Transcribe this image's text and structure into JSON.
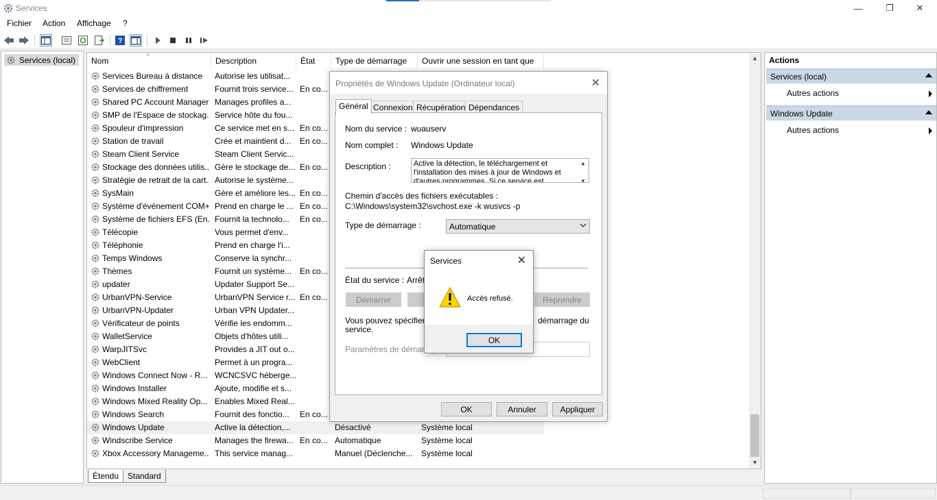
{
  "window": {
    "title": "Services",
    "controls": [
      "minimize-icon",
      "maximize-icon",
      "close-icon"
    ]
  },
  "menu": [
    "Fichier",
    "Action",
    "Affichage",
    "?"
  ],
  "tree": {
    "root": "Services (local)"
  },
  "columns": [
    "Nom",
    "Description",
    "État",
    "Type de démarrage",
    "Ouvrir une session en tant que"
  ],
  "rows": [
    {
      "name": "Services Bureau à distance",
      "desc": "Autorise les utilisat...",
      "state": "",
      "start": "",
      "logon": ""
    },
    {
      "name": "Services de chiffrement",
      "desc": "Fournit trois service...",
      "state": "En co...",
      "start": "",
      "logon": ""
    },
    {
      "name": "Shared PC Account Manager",
      "desc": "Manages profiles a...",
      "state": "",
      "start": "",
      "logon": ""
    },
    {
      "name": "SMP de l'Espace de stockag...",
      "desc": "Service hôte du fou...",
      "state": "",
      "start": "",
      "logon": ""
    },
    {
      "name": "Spouleur d'impression",
      "desc": "Ce service met en s...",
      "state": "En co...",
      "start": "",
      "logon": ""
    },
    {
      "name": "Station de travail",
      "desc": "Crée et maintient d...",
      "state": "En co...",
      "start": "",
      "logon": ""
    },
    {
      "name": "Steam Client Service",
      "desc": "Steam Client Servic...",
      "state": "",
      "start": "",
      "logon": ""
    },
    {
      "name": "Stockage des données utilis...",
      "desc": "Gère le stockage de...",
      "state": "En co...",
      "start": "",
      "logon": ""
    },
    {
      "name": "Stratégie de retrait de la cart...",
      "desc": "Autorise le système...",
      "state": "",
      "start": "",
      "logon": ""
    },
    {
      "name": "SysMain",
      "desc": "Gère et améliore les...",
      "state": "En co...",
      "start": "",
      "logon": ""
    },
    {
      "name": "Système d'événement COM+",
      "desc": "Prend en charge le ...",
      "state": "En co...",
      "start": "",
      "logon": ""
    },
    {
      "name": "Système de fichiers EFS (En...",
      "desc": "Fournit la technolo...",
      "state": "En co...",
      "start": "",
      "logon": ""
    },
    {
      "name": "Télécopie",
      "desc": "Vous permet d'env...",
      "state": "",
      "start": "",
      "logon": ""
    },
    {
      "name": "Téléphonie",
      "desc": "Prend en charge l'i...",
      "state": "",
      "start": "",
      "logon": ""
    },
    {
      "name": "Temps Windows",
      "desc": "Conserve la synchr...",
      "state": "",
      "start": "",
      "logon": ""
    },
    {
      "name": "Thèmes",
      "desc": "Fournit un système...",
      "state": "En co...",
      "start": "",
      "logon": ""
    },
    {
      "name": "updater",
      "desc": "Updater Support Se...",
      "state": "",
      "start": "",
      "logon": ""
    },
    {
      "name": "UrbanVPN-Service",
      "desc": "UrbanVPN Service r...",
      "state": "En co...",
      "start": "",
      "logon": ""
    },
    {
      "name": "UrbanVPN-Updater",
      "desc": "Urban VPN Updater...",
      "state": "",
      "start": "",
      "logon": ""
    },
    {
      "name": "Vérificateur de points",
      "desc": "Vérifie les endomm...",
      "state": "",
      "start": "",
      "logon": ""
    },
    {
      "name": "WalletService",
      "desc": "Objets d'hôtes utili...",
      "state": "",
      "start": "",
      "logon": ""
    },
    {
      "name": "WarpJITSvc",
      "desc": "Provides a JIT out o...",
      "state": "",
      "start": "",
      "logon": ""
    },
    {
      "name": "WebClient",
      "desc": "Permet à un progra...",
      "state": "",
      "start": "",
      "logon": ""
    },
    {
      "name": "Windows Connect Now - R...",
      "desc": "WCNCSVC héberge...",
      "state": "",
      "start": "",
      "logon": ""
    },
    {
      "name": "Windows Installer",
      "desc": "Ajoute, modifie et s...",
      "state": "",
      "start": "",
      "logon": ""
    },
    {
      "name": "Windows Mixed Reality Op...",
      "desc": "Enables Mixed Real...",
      "state": "",
      "start": "",
      "logon": ""
    },
    {
      "name": "Windows Search",
      "desc": "Fournit des fonctio...",
      "state": "En co...",
      "start": "",
      "logon": ""
    },
    {
      "name": "Windows Update",
      "desc": "Active la détection,...",
      "state": "",
      "start": "Désactivé",
      "logon": "Système local"
    },
    {
      "name": "Windscribe Service",
      "desc": "Manages the firewa...",
      "state": "En co...",
      "start": "Automatique",
      "logon": "Système local"
    },
    {
      "name": "Xbox Accessory Manageme...",
      "desc": "This service manag...",
      "state": "",
      "start": "Manuel (Déclenche...",
      "logon": "Système local"
    }
  ],
  "selected_row": 27,
  "bottom_tabs": [
    "Étendu",
    "Standard"
  ],
  "actions": {
    "title": "Actions",
    "sections": [
      {
        "title": "Services (local)",
        "item": "Autres actions"
      },
      {
        "title": "Windows Update",
        "item": "Autres actions"
      }
    ]
  },
  "props": {
    "title": "Propriétés de Windows Update (Ordinateur local)",
    "tabs": [
      "Général",
      "Connexion",
      "Récupération",
      "Dépendances"
    ],
    "service_name_label": "Nom du service :",
    "service_name": "wuauserv",
    "display_name_label": "Nom complet :",
    "display_name": "Windows Update",
    "description_label": "Description :",
    "description": "Active la détection, le téléchargement et l'installation des mises à jour de Windows et d'autres programmes. Si ce service est désactivé",
    "path_label": "Chemin d'accès des fichiers exécutables :",
    "path": "C:\\Windows\\system32\\svchost.exe -k wusvcs -p",
    "startup_label": "Type de démarrage :",
    "startup_value": "Automatique",
    "status_label": "État du service :",
    "status_value": "Arrêté",
    "btn_start": "Démarrer",
    "btn_resume": "Reprendre",
    "info_left": "Vous pouvez spécifier les",
    "info_right": "démarrage du",
    "info_line2": "service.",
    "params_label": "Paramètres de démarrage",
    "ok": "OK",
    "cancel": "Annuler",
    "apply": "Appliquer"
  },
  "msgbox": {
    "title": "Services",
    "text": "Accès refusé.",
    "ok": "OK",
    "icon": "warning-icon"
  },
  "colors": {
    "accent": "#0078d7",
    "section": "#c9d7e6"
  }
}
